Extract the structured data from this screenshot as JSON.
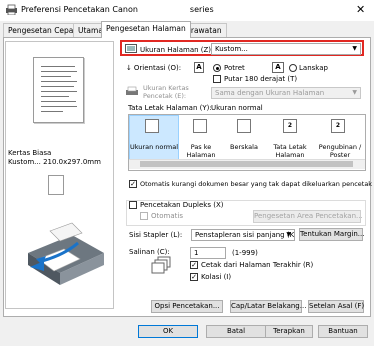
{
  "window": {
    "title": "Preferensi Pencetakan Canon",
    "title_suffix": "series",
    "close_glyph": "✕"
  },
  "tabs": [
    {
      "label": "Pengesetan Cepat"
    },
    {
      "label": "Utama"
    },
    {
      "label": "Pengesetan Halaman"
    },
    {
      "label": "Perawatan"
    }
  ],
  "preview": {
    "paper_type": "Kertas Biasa",
    "paper_size": "Kustom... 210.0x297.0mm"
  },
  "page_size": {
    "label": "Ukuran Halaman (Z):",
    "value": "Kustom..."
  },
  "orientation": {
    "label": "Orientasi (O):",
    "portrait": "Potret",
    "landscape": "Lanskap",
    "portrait_icon": "A",
    "landscape_icon": "A",
    "rotate": "Putar 180 derajat (T)",
    "portrait_selected": true
  },
  "paper_size": {
    "label": "Ukuran Kertas Pencetak (E):",
    "value": "Sama dengan Ukuran Halaman"
  },
  "layout": {
    "label": "Tata Letak Halaman (Y):",
    "current": "Ukuran normal",
    "items": [
      {
        "label": "Ukuran normal",
        "icon": ""
      },
      {
        "label": "Pas ke Halaman",
        "icon": ""
      },
      {
        "label": "Berskala",
        "icon": ""
      },
      {
        "label": "Tata Letak Halaman",
        "icon": "2"
      },
      {
        "label": "Pengubinan / Poster",
        "icon": "2"
      }
    ]
  },
  "auto_reduce": {
    "label": "Otomatis kurangi dokumen besar yang tak dapat dikeluarkan pencetak",
    "checked": true
  },
  "duplex": {
    "label": "Pencetakan Dupleks (X)",
    "auto": "Otomatis",
    "area_button": "Pengesetan Area Pencetakan...",
    "checked": false
  },
  "stapling": {
    "label": "Sisi Stapler (L):",
    "value": "Penstapleran sisi panjang (Kn)",
    "margin_button": "Tentukan Margin..."
  },
  "copies": {
    "label": "Salinan (C):",
    "value": "1",
    "range": "(1-999)",
    "reverse": "Cetak dari Halaman Terakhir (R)",
    "collate": "Kolasi (I)",
    "reverse_checked": true,
    "collate_checked": true
  },
  "buttons": {
    "print_options": "Opsi Pencetakan...",
    "stamp": "Cap/Latar Belakang...",
    "defaults": "Setelan Asal (F)",
    "ok": "OK",
    "cancel": "Batal",
    "apply": "Terapkan",
    "help": "Bantuan"
  },
  "colors": {
    "highlight": "#e12822",
    "selected_bg": "#cce8ff",
    "accent": "#0078d7"
  }
}
